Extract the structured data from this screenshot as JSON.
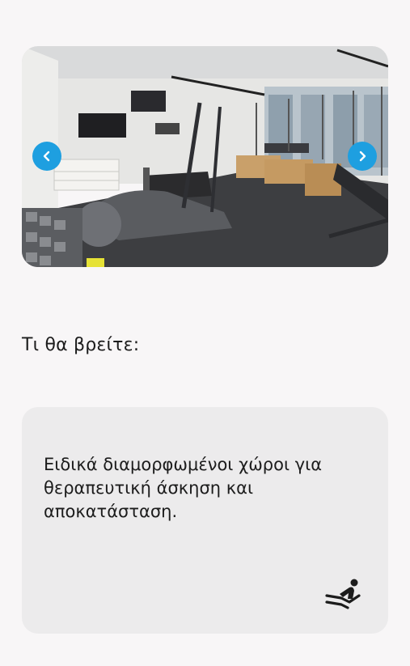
{
  "carousel": {
    "image_alt": "Gym interior with treadmill, elliptical trainer, reformer machines and weights",
    "prev_icon": "chevron-left-icon",
    "next_icon": "chevron-right-icon",
    "button_color": "#1e9fe0"
  },
  "section": {
    "title": "Τι θα βρείτε:"
  },
  "card": {
    "text": "Ειδικά διαμορφωμένοι χώροι για θεραπευτική άσκηση και αποκατάσταση.",
    "icon": "reclining-person-icon",
    "background": "#ecebec"
  }
}
